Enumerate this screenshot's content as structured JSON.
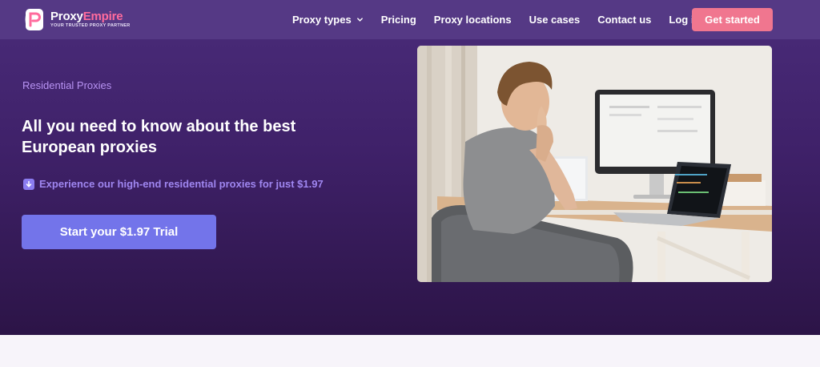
{
  "brand": {
    "name_part1": "Proxy",
    "name_part2": "Empire",
    "tagline": "YOUR TRUSTED PROXY PARTNER",
    "accent_color": "#ff6b9d"
  },
  "nav": {
    "items": [
      {
        "label": "Proxy types",
        "has_dropdown": true
      },
      {
        "label": "Pricing"
      },
      {
        "label": "Proxy locations"
      },
      {
        "label": "Use cases"
      },
      {
        "label": "Contact us"
      },
      {
        "label": "Log in"
      }
    ],
    "cta_label": "Get started",
    "cta_color": "#f0768f"
  },
  "hero": {
    "eyebrow": "Residential Proxies",
    "headline": "All you need to know about the best European proxies",
    "offer_icon": "download-arrow-icon",
    "offer_text": "Experience our high-end residential proxies for just $1.97",
    "button_label": "Start your $1.97 Trial",
    "button_color": "#7374ea",
    "background_color": "#3f2169",
    "image_subject": "person-at-desk-with-monitor-and-laptop"
  }
}
